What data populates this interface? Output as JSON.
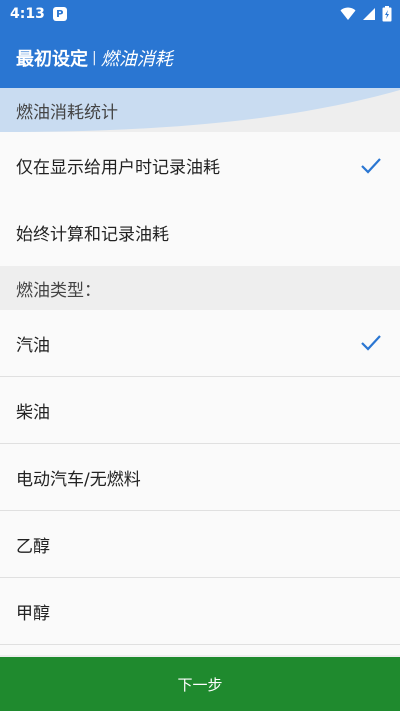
{
  "status_bar": {
    "time": "4:13",
    "notification_letter": "P"
  },
  "app_bar": {
    "title": "最初设定",
    "separator": "|",
    "subtitle": "燃油消耗"
  },
  "sections": {
    "consumption_header": "燃油消耗统计",
    "consumption_options": [
      {
        "label": "仅在显示给用户时记录油耗",
        "checked": true
      },
      {
        "label": "始终计算和记录油耗",
        "checked": false
      }
    ],
    "fuel_type_header": "燃油类型：",
    "fuel_types": [
      {
        "label": "汽油",
        "checked": true
      },
      {
        "label": "柴油",
        "checked": false
      },
      {
        "label": "电动汽车/无燃料",
        "checked": false
      },
      {
        "label": "乙醇",
        "checked": false
      },
      {
        "label": "甲醇",
        "checked": false
      }
    ]
  },
  "footer": {
    "next_label": "下一步"
  },
  "colors": {
    "primary": "#2a76d2",
    "check": "#2a76d2",
    "button": "#1f8a2e"
  }
}
